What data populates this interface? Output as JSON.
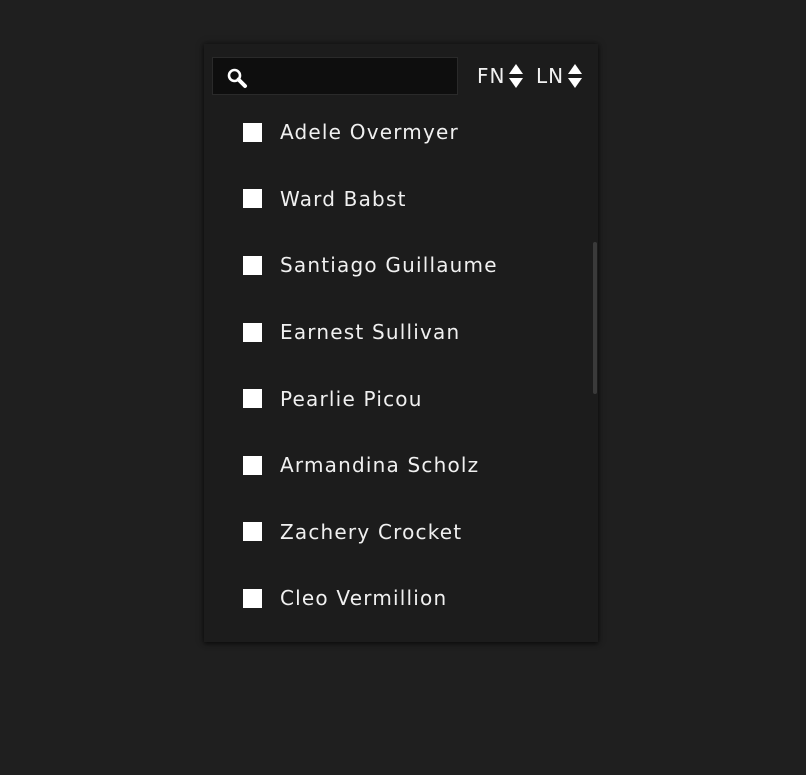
{
  "search": {
    "value": "",
    "placeholder": "",
    "icon": "search-icon"
  },
  "sort": {
    "first_name_label": "FN",
    "last_name_label": "LN"
  },
  "list": {
    "items": [
      {
        "label": "Adele Overmyer",
        "checked": false
      },
      {
        "label": "Ward Babst",
        "checked": false
      },
      {
        "label": "Santiago Guillaume",
        "checked": false
      },
      {
        "label": "Earnest Sullivan",
        "checked": false
      },
      {
        "label": "Pearlie Picou",
        "checked": false
      },
      {
        "label": "Armandina Scholz",
        "checked": false
      },
      {
        "label": "Zachery Crocket",
        "checked": false
      },
      {
        "label": "Cleo Vermillion",
        "checked": false
      }
    ]
  },
  "colors": {
    "background": "#1f1f1f",
    "panel": "#1c1c1c",
    "search_field": "#0e0e0e",
    "text": "#f0f0f0",
    "checkbox": "#ffffff"
  }
}
